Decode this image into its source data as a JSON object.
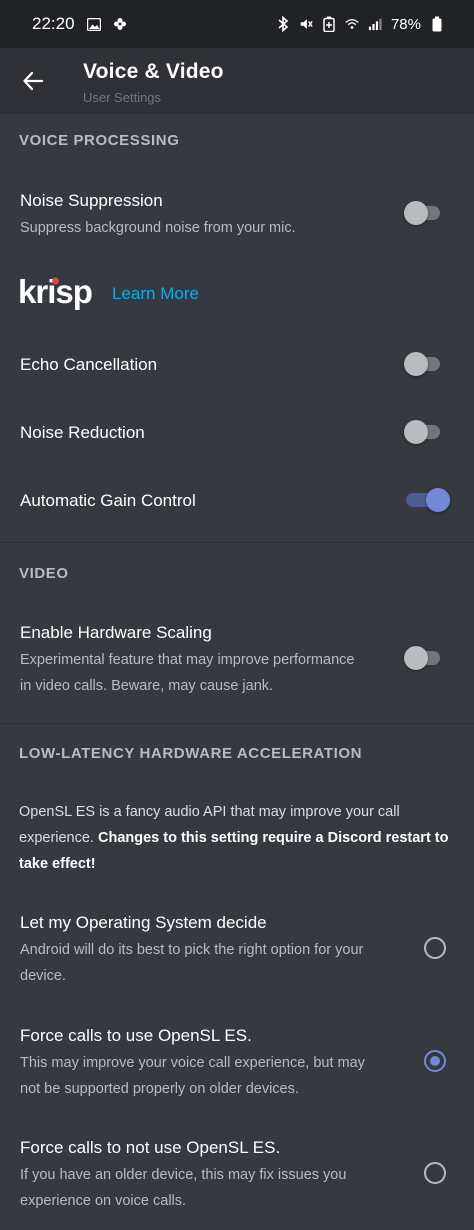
{
  "status_bar": {
    "time": "22:20",
    "battery": "78%",
    "icons": [
      "image-icon",
      "pinwheel-icon",
      "bluetooth-icon",
      "mute-icon",
      "battery-saver-icon",
      "wifi-icon",
      "signal-icon",
      "battery-icon"
    ]
  },
  "header": {
    "title": "Voice & Video",
    "subtitle": "User Settings",
    "back_icon": "arrow-left-icon"
  },
  "voice_processing": {
    "header": "VOICE PROCESSING",
    "noise_suppression": {
      "title": "Noise Suppression",
      "desc": "Suppress background noise from your mic.",
      "enabled": false
    },
    "krisp": {
      "logo_text": "krisp",
      "learn_more": "Learn More"
    },
    "echo_cancellation": {
      "title": "Echo Cancellation",
      "enabled": false
    },
    "noise_reduction": {
      "title": "Noise Reduction",
      "enabled": false
    },
    "automatic_gain_control": {
      "title": "Automatic Gain Control",
      "enabled": true
    }
  },
  "video": {
    "header": "VIDEO",
    "hardware_scaling": {
      "title": "Enable Hardware Scaling",
      "desc_line1": "Experimental feature that may improve performance",
      "desc_line2": "in video calls. Beware, may cause jank.",
      "enabled": false
    }
  },
  "hw_accel": {
    "header": "LOW-LATENCY HARDWARE ACCELERATION",
    "para_normal": "OpenSL ES is a fancy audio API that may improve your call experience. ",
    "para_bold": "Changes to this setting require a Discord restart to take effect!",
    "options": [
      {
        "title": "Let my Operating System decide",
        "desc_line1": "Android will do its best to pick the right option for your",
        "desc_line2": "device.",
        "selected": false
      },
      {
        "title": "Force calls to use OpenSL ES.",
        "desc_line1": "This may improve your voice call experience, but may",
        "desc_line2": "not be supported properly on older devices.",
        "selected": true
      },
      {
        "title": "Force calls to not use OpenSL ES.",
        "desc_line1": "If you have an older device, this may fix issues you",
        "desc_line2": "experience on voice calls.",
        "selected": false
      }
    ]
  },
  "colors": {
    "background": "#36393f",
    "header_bg": "#2f3136",
    "status_bg": "#202225",
    "accent": "#7289da",
    "link": "#00b0f4"
  }
}
